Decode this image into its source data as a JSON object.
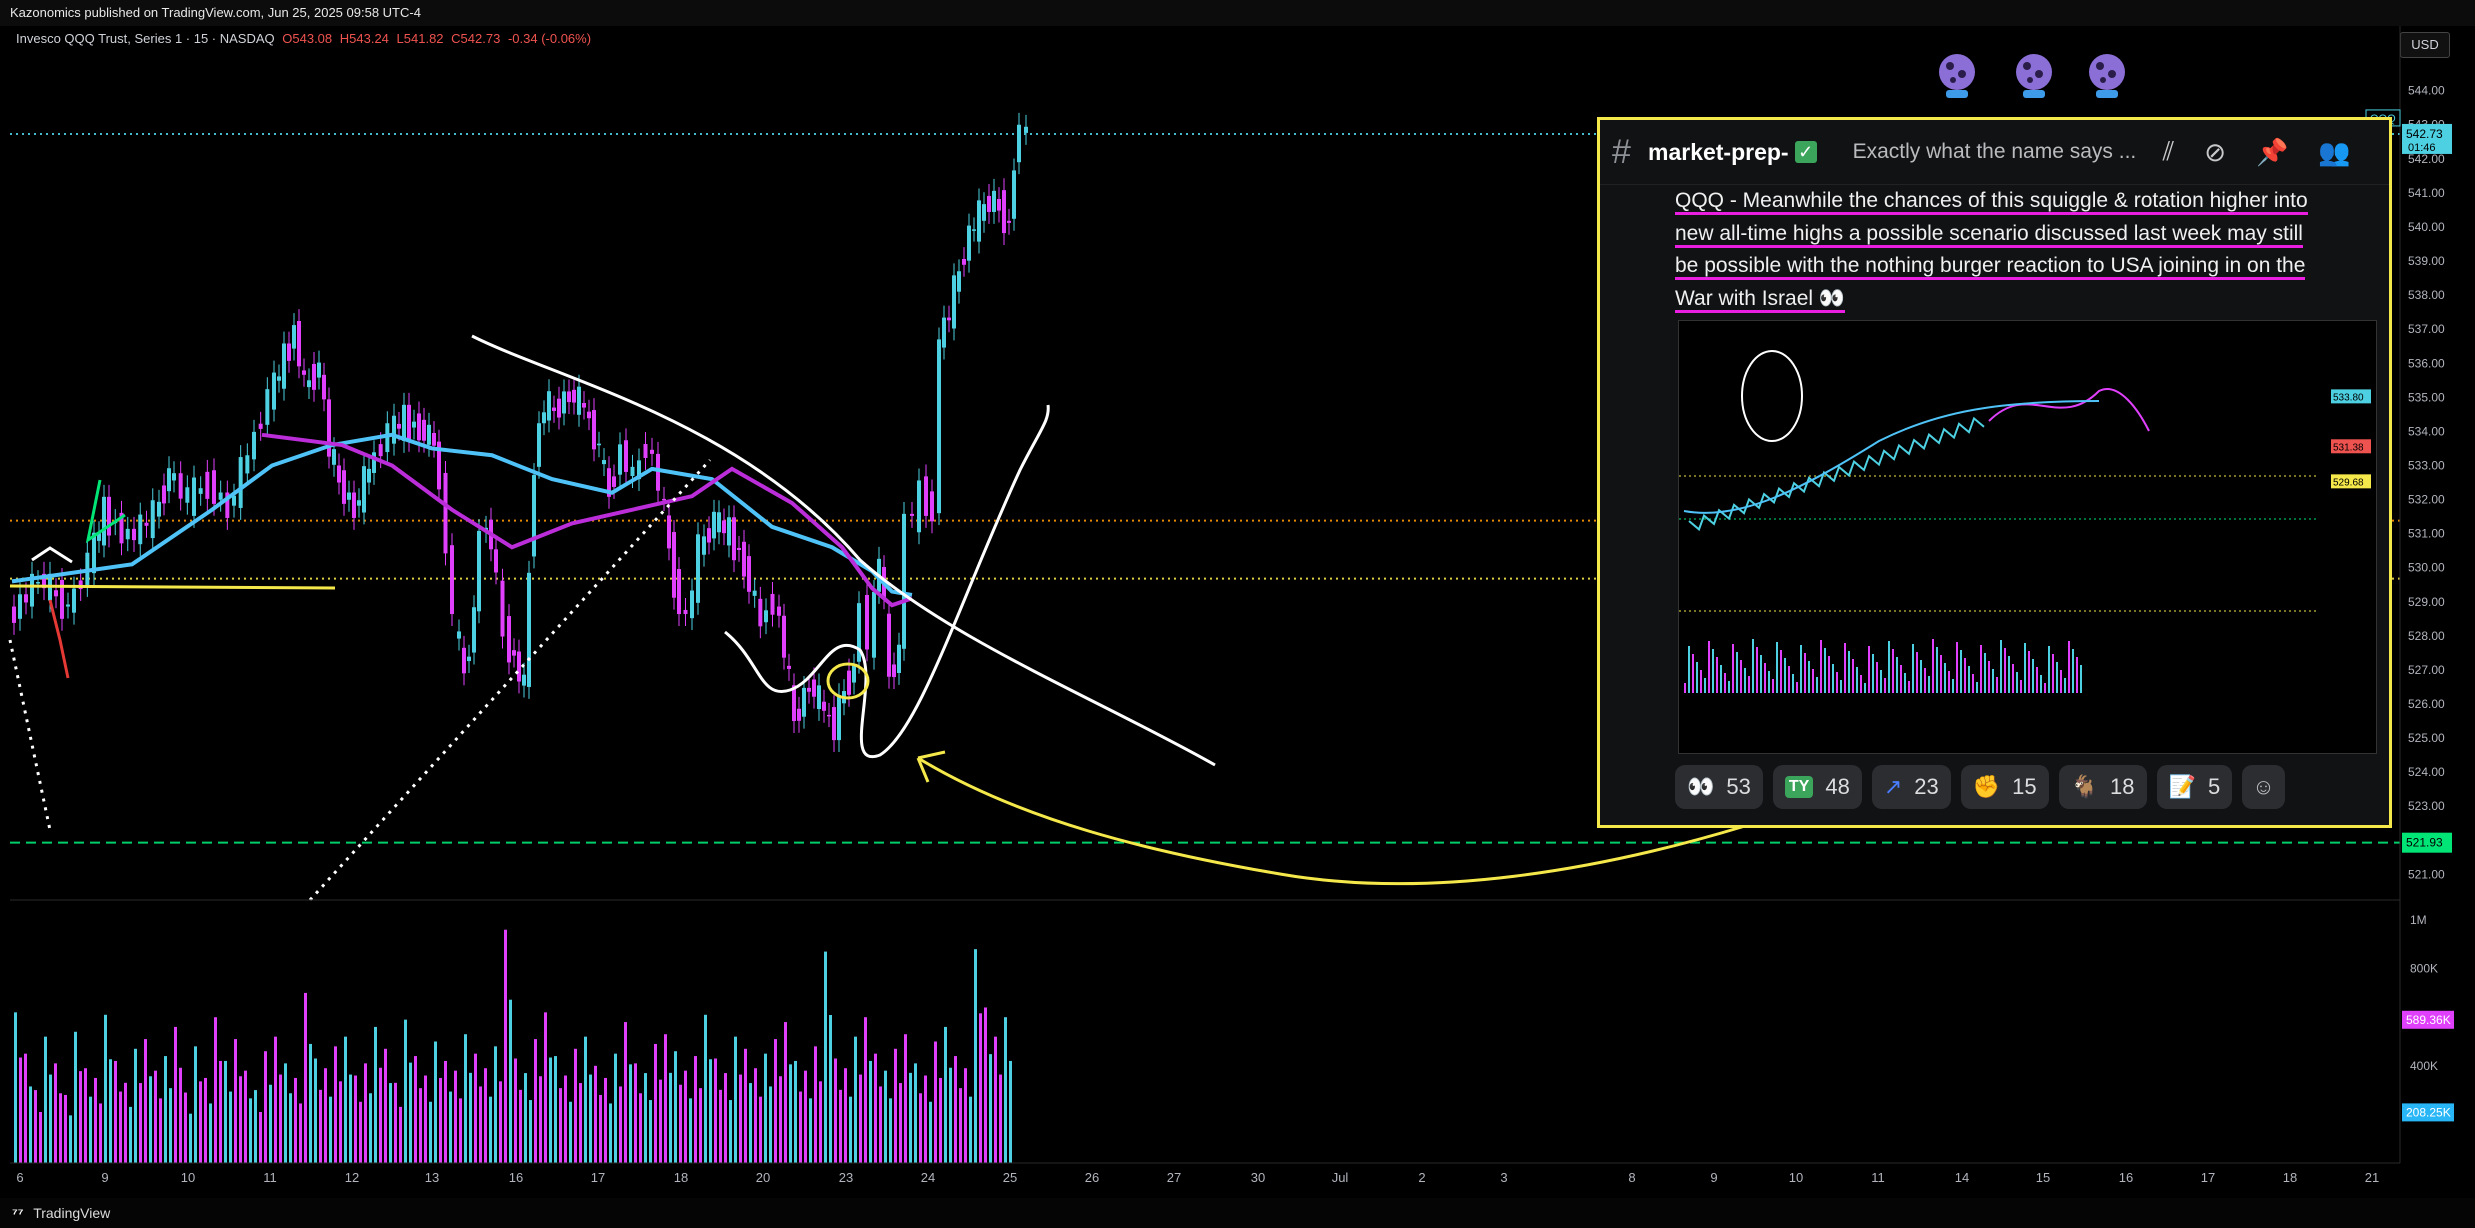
{
  "header": {
    "publish_line": "Kazonomics published on TradingView.com, Jun 25, 2025 09:58 UTC-4",
    "instrument": "Invesco QQQ Trust, Series 1 · 15 · NASDAQ",
    "o_label": "O543.08",
    "h_label": "H543.24",
    "l_label": "L541.82",
    "c_label": "C542.73",
    "change": "-0.34 (-0.06%)",
    "currency_button": "USD"
  },
  "footer": {
    "brand": "TradingView",
    "logo_icon": "tradingview-logo-icon"
  },
  "colors": {
    "up": "#4dd0e1",
    "down": "#e040fb",
    "ma_fast": "#4fc3f7",
    "ma_slow": "#ba2dd8",
    "yellow": "#f5e84a",
    "green": "#00e676",
    "orange": "#ff9800",
    "annotation": "#ffffff"
  },
  "chart_data": {
    "type": "candlestick",
    "price_axis": {
      "min": 520.6,
      "max": 544.9,
      "ticks": [
        "544.00",
        "543.00",
        "542.00",
        "541.00",
        "540.00",
        "539.00",
        "538.00",
        "537.00",
        "536.00",
        "535.00",
        "534.00",
        "533.00",
        "532.00",
        "531.00",
        "530.00",
        "529.00",
        "528.00",
        "527.00",
        "526.00",
        "525.00",
        "524.00",
        "523.00",
        "521.00"
      ],
      "tick_values": [
        544,
        543,
        542,
        541,
        540,
        539,
        538,
        537,
        536,
        535,
        534,
        533,
        532,
        531,
        530,
        529,
        528,
        527,
        526,
        525,
        524,
        523,
        521
      ]
    },
    "price_badges": [
      {
        "label": "QQQ",
        "value": 542.73,
        "text": "542.73",
        "sub": "01:46",
        "color": "#4dd0e1"
      },
      {
        "value": 521.93,
        "text": "521.93",
        "color": "#00e676"
      }
    ],
    "horizontal_levels": [
      {
        "value": 531.38,
        "style": "dotted",
        "color": "#ff9800"
      },
      {
        "value": 529.68,
        "style": "dotted",
        "color": "#f5e84a"
      },
      {
        "value": 521.93,
        "style": "dashed",
        "color": "#00e676"
      },
      {
        "value": 542.73,
        "style": "dotted",
        "color": "#4dd0e1"
      }
    ],
    "time_axis": {
      "labels": [
        "6",
        "9",
        "10",
        "11",
        "12",
        "13",
        "16",
        "17",
        "18",
        "20",
        "23",
        "24",
        "25",
        "26",
        "27",
        "30",
        "Jul",
        "2",
        "3",
        "8",
        "9",
        "10",
        "11",
        "14",
        "15",
        "16",
        "17",
        "18",
        "21"
      ]
    },
    "volume_axis": {
      "max": 1000000,
      "ticks": [
        "1M",
        "800K",
        "400K"
      ],
      "tick_values": [
        1000000,
        800000,
        400000
      ],
      "badges": [
        {
          "value": 589360,
          "text": "589.36K",
          "color": "#e040fb"
        },
        {
          "value": 208250,
          "text": "208.25K",
          "color": "#29b6f6"
        }
      ]
    },
    "price_path": [
      [
        0,
        528.5
      ],
      [
        30,
        529.7
      ],
      [
        60,
        528.8
      ],
      [
        80,
        530.2
      ],
      [
        95,
        531.6
      ],
      [
        120,
        530.9
      ],
      [
        145,
        531.5
      ],
      [
        160,
        532.8
      ],
      [
        180,
        532.0
      ],
      [
        200,
        532.5
      ],
      [
        220,
        531.7
      ],
      [
        240,
        533.3
      ],
      [
        260,
        535.0
      ],
      [
        275,
        536.1
      ],
      [
        285,
        537.0
      ],
      [
        295,
        535.3
      ],
      [
        310,
        535.9
      ],
      [
        320,
        533.5
      ],
      [
        330,
        532.5
      ],
      [
        345,
        531.7
      ],
      [
        360,
        532.9
      ],
      [
        380,
        534.0
      ],
      [
        395,
        534.3
      ],
      [
        410,
        534.1
      ],
      [
        425,
        533.7
      ],
      [
        438,
        530.9
      ],
      [
        445,
        528.4
      ],
      [
        455,
        526.9
      ],
      [
        465,
        528.6
      ],
      [
        472,
        531.2
      ],
      [
        482,
        530.9
      ],
      [
        495,
        528.1
      ],
      [
        505,
        527.3
      ],
      [
        515,
        526.5
      ],
      [
        525,
        533.2
      ],
      [
        535,
        534.8
      ],
      [
        545,
        534.6
      ],
      [
        560,
        535.1
      ],
      [
        575,
        534.7
      ],
      [
        590,
        533.4
      ],
      [
        600,
        532.2
      ],
      [
        612,
        533.5
      ],
      [
        625,
        532.6
      ],
      [
        638,
        533.7
      ],
      [
        650,
        532.5
      ],
      [
        665,
        529.6
      ],
      [
        678,
        528.4
      ],
      [
        690,
        530.5
      ],
      [
        705,
        531.4
      ],
      [
        720,
        531.0
      ],
      [
        735,
        530.1
      ],
      [
        752,
        528.4
      ],
      [
        765,
        529.1
      ],
      [
        775,
        527.6
      ],
      [
        785,
        525.5
      ],
      [
        800,
        526.6
      ],
      [
        815,
        525.8
      ],
      [
        825,
        525.3
      ],
      [
        835,
        526.5
      ],
      [
        845,
        527.0
      ],
      [
        853,
        529.2
      ],
      [
        860,
        527.6
      ],
      [
        870,
        530.5
      ],
      [
        880,
        526.8
      ],
      [
        890,
        527.5
      ],
      [
        898,
        531.7
      ],
      [
        905,
        531.4
      ],
      [
        912,
        532.2
      ],
      [
        918,
        532.0
      ],
      [
        925,
        531.6
      ],
      [
        930,
        536.7
      ],
      [
        940,
        537.5
      ],
      [
        950,
        538.7
      ],
      [
        960,
        539.8
      ],
      [
        970,
        540.3
      ],
      [
        980,
        540.8
      ],
      [
        990,
        540.6
      ],
      [
        1000,
        540.0
      ],
      [
        1005,
        541.9
      ],
      [
        1012,
        543.0
      ],
      [
        1015,
        542.7
      ]
    ],
    "volume": [
      620,
      450,
      300,
      520,
      410,
      280,
      540,
      390,
      350,
      610,
      420,
      330,
      470,
      510,
      380,
      440,
      560,
      290,
      480,
      350,
      600,
      420,
      510,
      380,
      300,
      460,
      520,
      410,
      350,
      700,
      430,
      390,
      480,
      520,
      360,
      410,
      560,
      470,
      330,
      590,
      440,
      360,
      500,
      420,
      380,
      530,
      450,
      390,
      480,
      960,
      430,
      370,
      510,
      620,
      440,
      360,
      470,
      520,
      400,
      350,
      450,
      580,
      410,
      370,
      490,
      530,
      460,
      380,
      440,
      610,
      430,
      370,
      520,
      470,
      390,
      450,
      510,
      580,
      420,
      380,
      480,
      870,
      430,
      390,
      520,
      600,
      450,
      380,
      470,
      530,
      410,
      360,
      500,
      560,
      440,
      390,
      880,
      640,
      520,
      600
    ],
    "ma_fast": [
      [
        0,
        529.6
      ],
      [
        120,
        530.1
      ],
      [
        200,
        531.7
      ],
      [
        260,
        533.0
      ],
      [
        320,
        533.6
      ],
      [
        380,
        533.9
      ],
      [
        420,
        533.5
      ],
      [
        480,
        533.3
      ],
      [
        540,
        532.6
      ],
      [
        600,
        532.2
      ],
      [
        640,
        532.9
      ],
      [
        700,
        532.6
      ],
      [
        760,
        531.2
      ],
      [
        820,
        530.6
      ],
      [
        860,
        529.9
      ],
      [
        880,
        529.3
      ],
      [
        900,
        529.2
      ]
    ],
    "ma_slow": [
      [
        250,
        533.9
      ],
      [
        330,
        533.6
      ],
      [
        380,
        533.0
      ],
      [
        440,
        531.7
      ],
      [
        500,
        530.6
      ],
      [
        560,
        531.3
      ],
      [
        620,
        531.7
      ],
      [
        680,
        532.1
      ],
      [
        720,
        532.9
      ],
      [
        780,
        531.9
      ],
      [
        830,
        530.6
      ],
      [
        860,
        529.4
      ],
      [
        880,
        528.9
      ],
      [
        900,
        529.1
      ]
    ]
  },
  "discord": {
    "channel": "market-prep-",
    "check_glyph": "✓",
    "topic": "Exactly what the name says ...",
    "header_icons": [
      "threads-icon",
      "mute-icon",
      "pin-icon",
      "members-icon"
    ],
    "message_lines": [
      "QQQ - Meanwhile the chances of this squiggle & rotation higher into",
      "new all-time highs a possible scenario discussed last week may still",
      "be possible with the nothing burger reaction to USA joining in on the",
      "War with Israel 👀"
    ],
    "reactions": [
      {
        "emoji": "👀",
        "count": "53",
        "icon": "eyes-emoji-icon"
      },
      {
        "emoji": "TY",
        "count": "48",
        "icon": "thank-you-emoji-icon"
      },
      {
        "emoji": "↗",
        "count": "23",
        "icon": "chart-up-emoji-icon"
      },
      {
        "emoji": "✊",
        "count": "15",
        "icon": "fist-emoji-icon"
      },
      {
        "emoji": "🐐",
        "count": "18",
        "icon": "goat-emoji-icon"
      },
      {
        "emoji": "📝",
        "count": "5",
        "icon": "memo-emoji-icon"
      }
    ],
    "add_reaction_icon": "add-reaction-icon",
    "mini_chart": {
      "badges": [
        "533.80",
        "531.38",
        "529.68"
      ],
      "badge_values": [
        533.8,
        531.38,
        529.68
      ],
      "badge_colors": [
        "#4dd0e1",
        "#ef5350",
        "#f5e84a"
      ]
    }
  },
  "decorations": {
    "crystal_ball_icons": [
      "crystal-ball-icon",
      "crystal-ball-icon",
      "crystal-ball-icon"
    ]
  }
}
